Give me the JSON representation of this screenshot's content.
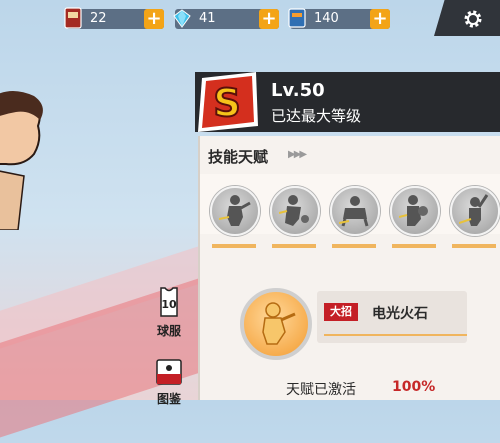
{
  "resources": [
    {
      "name": "card",
      "icon": "card-icon",
      "value": "22"
    },
    {
      "name": "diamond",
      "icon": "diamond-icon",
      "value": "41"
    },
    {
      "name": "ticket",
      "icon": "ticket-icon",
      "value": "140"
    }
  ],
  "plus_label": "+",
  "header": {
    "badge_letter": "S",
    "level": "Lv.50",
    "status": "已达最大等级"
  },
  "talent": {
    "section_title": "技能天赋",
    "arrows": "▶▶▶",
    "skills": [
      {
        "icon": "punching-player-icon",
        "level_fill": 1.0
      },
      {
        "icon": "dribbling-player-icon",
        "level_fill": 1.0
      },
      {
        "icon": "crouching-player-icon",
        "level_fill": 1.0
      },
      {
        "icon": "ball-holding-player-icon",
        "level_fill": 1.0
      },
      {
        "icon": "shooting-player-icon",
        "level_fill": 1.0
      }
    ],
    "ultimate": {
      "badge": "大招",
      "name": "电光火石",
      "icon": "lightning-strike-icon"
    },
    "activated_label": "天赋已激活",
    "activated_value": "100%"
  },
  "nav": [
    {
      "label": "球服",
      "icon": "jersey-icon",
      "number": "10"
    },
    {
      "label": "图鉴",
      "icon": "book-icon"
    }
  ],
  "colors": {
    "accent_orange": "#f3a417",
    "header_dark": "#27292d",
    "badge_red": "#c41f26",
    "skill_bar": "#f0b55e"
  }
}
